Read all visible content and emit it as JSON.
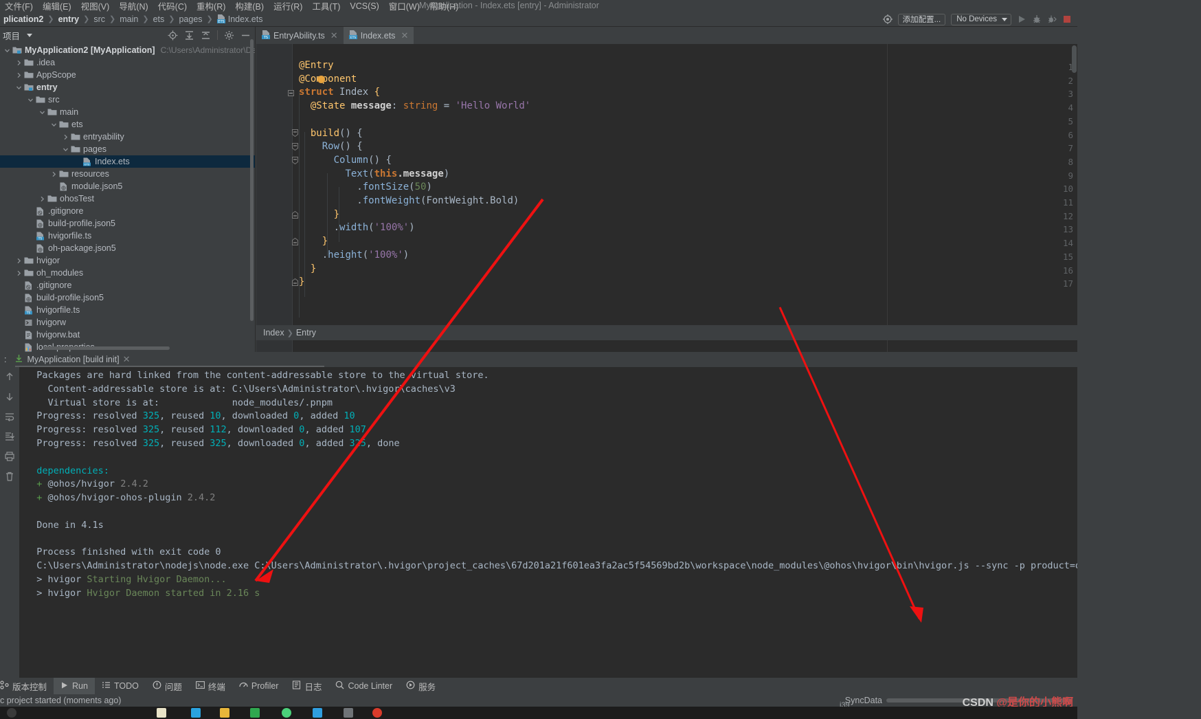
{
  "window": {
    "title": "MyApplication - Index.ets [entry] - Administrator"
  },
  "menubar": {
    "items": [
      {
        "label": "文件(F)"
      },
      {
        "label": "编辑(E)"
      },
      {
        "label": "视图(V)"
      },
      {
        "label": "导航(N)"
      },
      {
        "label": "代码(C)"
      },
      {
        "label": "重构(R)"
      },
      {
        "label": "构建(B)"
      },
      {
        "label": "运行(R)"
      },
      {
        "label": "工具(T)"
      },
      {
        "label": "VCS(S)"
      },
      {
        "label": "窗口(W)"
      },
      {
        "label": "帮助(H)"
      }
    ]
  },
  "breadcrumb": {
    "items": [
      "plication2",
      "entry",
      "src",
      "main",
      "ets",
      "pages",
      "Index.ets"
    ]
  },
  "toolbar": {
    "settings_icon": "target-icon",
    "add_config_label": "添加配置...",
    "device_label": "No Devices",
    "run_icon": "run-icon",
    "debug_icon": "debug-icon",
    "profile_icon": "profile-debug-icon",
    "stop_icon": "stop-icon"
  },
  "project_panel": {
    "title": "项目",
    "tools": [
      "locate-icon",
      "expand-all-icon",
      "collapse-all-icon",
      "gear-icon",
      "minimize-icon"
    ],
    "tree": [
      {
        "indent": 0,
        "arrow": "down",
        "icon": "module-icon",
        "name": "MyApplication2",
        "module": "[MyApplication]",
        "path": "C:\\Users\\Administrator\\DevEcoStu",
        "bold": true
      },
      {
        "indent": 1,
        "arrow": "right",
        "icon": "folder",
        "name": ".idea"
      },
      {
        "indent": 1,
        "arrow": "right",
        "icon": "folder",
        "name": "AppScope"
      },
      {
        "indent": 1,
        "arrow": "down",
        "icon": "module-icon",
        "name": "entry",
        "bold": true
      },
      {
        "indent": 2,
        "arrow": "down",
        "icon": "folder",
        "name": "src"
      },
      {
        "indent": 3,
        "arrow": "down",
        "icon": "folder",
        "name": "main"
      },
      {
        "indent": 4,
        "arrow": "down",
        "icon": "folder",
        "name": "ets"
      },
      {
        "indent": 5,
        "arrow": "right",
        "icon": "folder",
        "name": "entryability"
      },
      {
        "indent": 5,
        "arrow": "down",
        "icon": "folder",
        "name": "pages"
      },
      {
        "indent": 6,
        "arrow": "none",
        "icon": "ets-file",
        "name": "Index.ets",
        "selected": true
      },
      {
        "indent": 4,
        "arrow": "right",
        "icon": "folder",
        "name": "resources"
      },
      {
        "indent": 4,
        "arrow": "none",
        "icon": "json5-file",
        "name": "module.json5"
      },
      {
        "indent": 3,
        "arrow": "right",
        "icon": "folder",
        "name": "ohosTest"
      },
      {
        "indent": 2,
        "arrow": "none",
        "icon": "gitignore-file",
        "name": ".gitignore"
      },
      {
        "indent": 2,
        "arrow": "none",
        "icon": "json5-file",
        "name": "build-profile.json5"
      },
      {
        "indent": 2,
        "arrow": "none",
        "icon": "ts-file",
        "name": "hvigorfile.ts"
      },
      {
        "indent": 2,
        "arrow": "none",
        "icon": "json5-file",
        "name": "oh-package.json5"
      },
      {
        "indent": 1,
        "arrow": "right",
        "icon": "folder",
        "name": "hvigor"
      },
      {
        "indent": 1,
        "arrow": "right",
        "icon": "folder",
        "name": "oh_modules"
      },
      {
        "indent": 1,
        "arrow": "none",
        "icon": "gitignore-file",
        "name": ".gitignore"
      },
      {
        "indent": 1,
        "arrow": "none",
        "icon": "json5-file",
        "name": "build-profile.json5"
      },
      {
        "indent": 1,
        "arrow": "none",
        "icon": "ts-file",
        "name": "hvigorfile.ts"
      },
      {
        "indent": 1,
        "arrow": "none",
        "icon": "script-file",
        "name": "hvigorw"
      },
      {
        "indent": 1,
        "arrow": "none",
        "icon": "bat-file",
        "name": "hvigorw.bat"
      },
      {
        "indent": 1,
        "arrow": "none",
        "icon": "props-file",
        "name": "local.properties"
      }
    ]
  },
  "editor": {
    "tabs": [
      {
        "label": "EntryAbility.ts",
        "icon": "ts-file",
        "active": false
      },
      {
        "label": "Index.ets",
        "icon": "ets-file",
        "active": true
      }
    ],
    "line_numbers": [
      1,
      2,
      3,
      4,
      5,
      6,
      7,
      8,
      9,
      10,
      11,
      12,
      13,
      14,
      15,
      16,
      17
    ],
    "code": [
      [
        {
          "t": "@Entry",
          "c": "k-yellow"
        }
      ],
      [
        {
          "t": "@Component",
          "c": "k-yellow"
        }
      ],
      [
        {
          "t": "struct ",
          "c": "k-orange k-bold"
        },
        {
          "t": "Index",
          "c": "k-gray"
        },
        {
          "t": " {",
          "c": "k-yellow"
        }
      ],
      [
        {
          "t": "  @State ",
          "c": "k-yellow"
        },
        {
          "t": "message",
          "c": "k-white k-bold"
        },
        {
          "t": ": ",
          "c": "k-gray"
        },
        {
          "t": "string",
          "c": "k-orange"
        },
        {
          "t": " = ",
          "c": "k-gray"
        },
        {
          "t": "'Hello World'",
          "c": "k-purple"
        }
      ],
      [],
      [
        {
          "t": "  ",
          "c": "k-gray"
        },
        {
          "t": "build",
          "c": "k-yellow"
        },
        {
          "t": "() {",
          "c": "k-gray"
        }
      ],
      [
        {
          "t": "    ",
          "c": "k-gray"
        },
        {
          "t": "Row",
          "c": "k-lblue"
        },
        {
          "t": "() {",
          "c": "k-gray"
        }
      ],
      [
        {
          "t": "      ",
          "c": "k-gray"
        },
        {
          "t": "Column",
          "c": "k-lblue"
        },
        {
          "t": "() {",
          "c": "k-gray"
        }
      ],
      [
        {
          "t": "        ",
          "c": "k-gray"
        },
        {
          "t": "Text",
          "c": "k-lblue"
        },
        {
          "t": "(",
          "c": "k-gray"
        },
        {
          "t": "this",
          "c": "k-orange k-bold"
        },
        {
          "t": ".message",
          "c": "k-white k-bold"
        },
        {
          "t": ")",
          "c": "k-gray"
        }
      ],
      [
        {
          "t": "          .",
          "c": "k-gray"
        },
        {
          "t": "fontSize",
          "c": "k-lblue"
        },
        {
          "t": "(",
          "c": "k-gray"
        },
        {
          "t": "50",
          "c": "k-green"
        },
        {
          "t": ")",
          "c": "k-gray"
        }
      ],
      [
        {
          "t": "          .",
          "c": "k-gray"
        },
        {
          "t": "fontWeight",
          "c": "k-lblue"
        },
        {
          "t": "(",
          "c": "k-gray"
        },
        {
          "t": "FontWeight.Bold",
          "c": "k-gray"
        },
        {
          "t": ")",
          "c": "k-gray"
        }
      ],
      [
        {
          "t": "      }",
          "c": "k-yellow"
        }
      ],
      [
        {
          "t": "      .",
          "c": "k-gray"
        },
        {
          "t": "width",
          "c": "k-lblue"
        },
        {
          "t": "(",
          "c": "k-gray"
        },
        {
          "t": "'100%'",
          "c": "k-purple"
        },
        {
          "t": ")",
          "c": "k-gray"
        }
      ],
      [
        {
          "t": "    }",
          "c": "k-yellow"
        }
      ],
      [
        {
          "t": "    .",
          "c": "k-gray"
        },
        {
          "t": "height",
          "c": "k-lblue"
        },
        {
          "t": "(",
          "c": "k-gray"
        },
        {
          "t": "'100%'",
          "c": "k-purple"
        },
        {
          "t": ")",
          "c": "k-gray"
        }
      ],
      [
        {
          "t": "  }",
          "c": "k-yellow"
        }
      ],
      [
        {
          "t": "}",
          "c": "k-yellow"
        }
      ]
    ],
    "status_breadcrumb": [
      "Index",
      "Entry"
    ]
  },
  "run_window": {
    "tab_label": "MyApplication [build init]",
    "tab_icon": "build-init-icon",
    "side_icons": [
      "up-arrow-icon",
      "down-arrow-icon",
      "soft-wrap-icon",
      "scroll-to-end-icon",
      "print-icon",
      "trash-icon"
    ],
    "console": [
      [
        {
          "t": "  Packages are hard linked from the content-addressable store to the virtual store.",
          "c": "c-gray"
        }
      ],
      [
        {
          "t": "    Content-addressable store is at: C:\\Users\\Administrator\\.hvigor\\caches\\v3",
          "c": "c-gray"
        }
      ],
      [
        {
          "t": "    Virtual store is at:             node_modules/.pnpm",
          "c": "c-gray"
        }
      ],
      [
        {
          "t": "  Progress: resolved ",
          "c": "c-gray"
        },
        {
          "t": "325",
          "c": "c-cyan"
        },
        {
          "t": ", reused ",
          "c": "c-gray"
        },
        {
          "t": "10",
          "c": "c-cyan"
        },
        {
          "t": ", downloaded ",
          "c": "c-gray"
        },
        {
          "t": "0",
          "c": "c-cyan"
        },
        {
          "t": ", added ",
          "c": "c-gray"
        },
        {
          "t": "10",
          "c": "c-cyan"
        }
      ],
      [
        {
          "t": "  Progress: resolved ",
          "c": "c-gray"
        },
        {
          "t": "325",
          "c": "c-cyan"
        },
        {
          "t": ", reused ",
          "c": "c-gray"
        },
        {
          "t": "112",
          "c": "c-cyan"
        },
        {
          "t": ", downloaded ",
          "c": "c-gray"
        },
        {
          "t": "0",
          "c": "c-cyan"
        },
        {
          "t": ", added ",
          "c": "c-gray"
        },
        {
          "t": "107",
          "c": "c-cyan"
        }
      ],
      [
        {
          "t": "  Progress: resolved ",
          "c": "c-gray"
        },
        {
          "t": "325",
          "c": "c-cyan"
        },
        {
          "t": ", reused ",
          "c": "c-gray"
        },
        {
          "t": "325",
          "c": "c-cyan"
        },
        {
          "t": ", downloaded ",
          "c": "c-gray"
        },
        {
          "t": "0",
          "c": "c-cyan"
        },
        {
          "t": ", added ",
          "c": "c-gray"
        },
        {
          "t": "325",
          "c": "c-cyan"
        },
        {
          "t": ", done",
          "c": "c-gray"
        }
      ],
      [],
      [
        {
          "t": "  dependencies:",
          "c": "c-cyan"
        }
      ],
      [
        {
          "t": "  + ",
          "c": "c-lgreen"
        },
        {
          "t": "@ohos/hvigor ",
          "c": "c-gray"
        },
        {
          "t": "2.4.2",
          "c": "c-dim"
        }
      ],
      [
        {
          "t": "  + ",
          "c": "c-lgreen"
        },
        {
          "t": "@ohos/hvigor-ohos-plugin ",
          "c": "c-gray"
        },
        {
          "t": "2.4.2",
          "c": "c-dim"
        }
      ],
      [],
      [
        {
          "t": "  Done in 4.1s",
          "c": "c-gray"
        }
      ],
      [],
      [
        {
          "t": "  Process finished with exit code 0",
          "c": "c-gray"
        }
      ],
      [
        {
          "t": "  C:\\Users\\Administrator\\nodejs\\node.exe C:\\Users\\Administrator\\.hvigor\\project_caches\\67d201a21f601ea3fa2ac5f54569bd2b\\workspace\\node_modules\\@ohos\\hvigor\\bin\\hvigor.js --sync -p product=default",
          "c": "c-gray"
        }
      ],
      [
        {
          "t": "  > hvigor ",
          "c": "c-gray"
        },
        {
          "t": "Starting Hvigor Daemon...",
          "c": "c-green"
        }
      ],
      [
        {
          "t": "  > hvigor ",
          "c": "c-gray"
        },
        {
          "t": "Hvigor Daemon started in 2.16 s",
          "c": "c-green"
        }
      ]
    ]
  },
  "statusbar": {
    "items": [
      {
        "label": "版本控制",
        "icon": "vcs-icon",
        "active": false
      },
      {
        "label": "Run",
        "icon": "run-icon",
        "active": true
      },
      {
        "label": "TODO",
        "icon": "todo-icon",
        "active": false
      },
      {
        "label": "问题",
        "icon": "problems-icon",
        "active": false
      },
      {
        "label": "终端",
        "icon": "terminal-icon",
        "active": false
      },
      {
        "label": "Profiler",
        "icon": "profiler-icon",
        "active": false
      },
      {
        "label": "日志",
        "icon": "log-icon",
        "active": false
      },
      {
        "label": "Code Linter",
        "icon": "code-linter-icon",
        "active": false
      },
      {
        "label": "服务",
        "icon": "services-icon",
        "active": false
      }
    ],
    "message": "c project started (moments ago)",
    "sync_label": "SyncData",
    "ime_label": "i39"
  },
  "watermark": {
    "prefix": "CSDN ",
    "handle": "@是你的小熊啊"
  },
  "colors": {
    "accent_blue": "#0d293e",
    "console_cyan": "#00b0b8",
    "console_green": "#6a8759",
    "annotation_red": "#ee1111",
    "panel_bg": "#3c3f41",
    "editor_bg": "#2b2b2b"
  }
}
